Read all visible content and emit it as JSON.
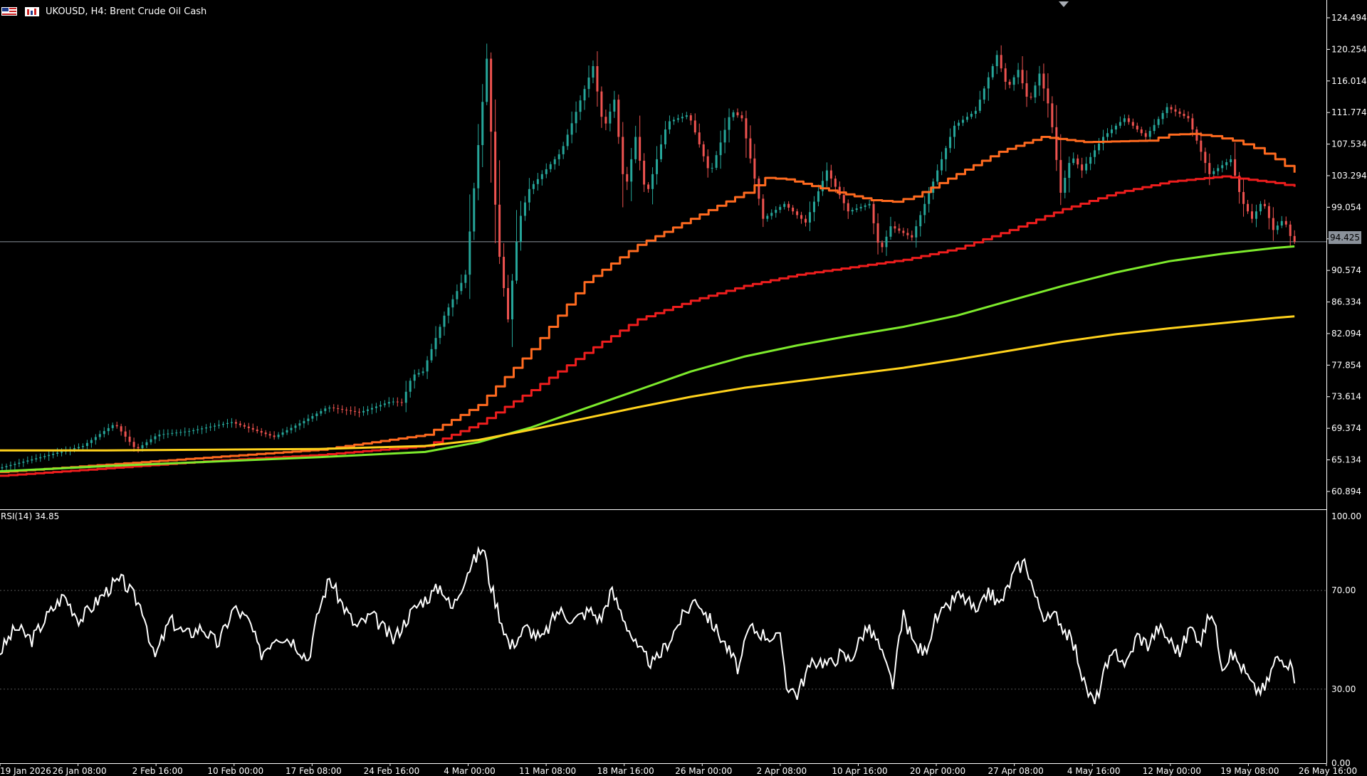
{
  "window": {
    "symbol_title": "UKOUSD, H4:  Brent Crude Oil Cash",
    "current_price": "94.425"
  },
  "colors": {
    "background": "#000000",
    "axis": "#ffffff",
    "ma_orange": "#ff6a1f",
    "ma_red": "#ee1d1d",
    "ma_green": "#7dea2c",
    "ma_yellow": "#ffd21c",
    "bull_candle": "#26a69a",
    "bear_candle": "#ef5350",
    "rsi_line": "#ffffff",
    "rsi_levels": "#555555"
  },
  "icons": [
    "flag-icon",
    "chart-type-icon"
  ],
  "chart_data": [
    {
      "type": "line",
      "title": "UKOUSD, H4:  Brent Crude Oil Cash",
      "price_ticks": [
        "124.494",
        "120.254",
        "116.014",
        "111.774",
        "107.534",
        "103.294",
        "99.054",
        "94.814",
        "90.574",
        "86.334",
        "82.094",
        "77.854",
        "73.614",
        "69.374",
        "65.134",
        "60.894"
      ],
      "ylim": [
        58.5,
        126.5
      ],
      "x_ticks": [
        "19 Jan 2026",
        "26 Jan 08:00",
        "2 Feb 16:00",
        "10 Feb 00:00",
        "17 Feb 08:00",
        "24 Feb 16:00",
        "4 Mar 00:00",
        "11 Mar 08:00",
        "18 Mar 16:00",
        "26 Mar 00:00",
        "2 Apr 08:00",
        "10 Apr 16:00",
        "20 Apr 00:00",
        "27 Apr 08:00",
        "4 May 16:00",
        "12 May 00:00",
        "19 May 08:00",
        "26 May 16:00"
      ],
      "xlim": [
        0,
        1248
      ],
      "price": {
        "x": [
          0,
          40,
          80,
          110,
          130,
          150,
          180,
          220,
          260,
          290,
          310,
          340,
          370,
          380,
          390,
          400,
          420,
          440,
          460,
          470,
          480,
          490,
          500,
          530,
          560,
          570,
          580,
          590,
          600,
          610,
          630,
          650,
          670,
          690,
          700,
          720,
          740,
          760,
          780,
          800,
          820,
          830,
          840,
          860,
          880,
          900,
          920,
          940,
          950,
          960,
          970,
          980,
          990,
          1000,
          1010,
          1020,
          1040,
          1060,
          1080,
          1100,
          1120,
          1140,
          1160,
          1170,
          1180,
          1190,
          1200,
          1210,
          1218
        ],
        "y": [
          64.0,
          65.5,
          67.0,
          70.0,
          66.5,
          68.5,
          69.0,
          70.2,
          68.2,
          70.5,
          72.2,
          71.5,
          73.0,
          72.8,
          76.5,
          77.0,
          84.5,
          90.0,
          119.0,
          94.5,
          84.0,
          97.0,
          101.5,
          106.5,
          118.0,
          109.5,
          113.5,
          101.0,
          108.5,
          100.5,
          110.5,
          111.5,
          103.5,
          112.0,
          111.0,
          97.5,
          99.5,
          97.0,
          104.0,
          98.5,
          99.5,
          93.0,
          96.5,
          95.0,
          102.5,
          110.0,
          112.0,
          119.5,
          115.0,
          117.5,
          113.0,
          117.0,
          112.0,
          101.0,
          106.0,
          104.0,
          108.5,
          111.0,
          108.5,
          112.5,
          111.0,
          103.5,
          105.5,
          100.0,
          97.5,
          100.0,
          96.0,
          97.5,
          94.425
        ]
      },
      "series": [
        {
          "name": "",
          "color": "#ff6a1f",
          "step": true,
          "x": [
            0,
            100,
            200,
            300,
            400,
            450,
            500,
            550,
            600,
            650,
            700,
            720,
            740,
            780,
            820,
            840,
            860,
            900,
            940,
            980,
            1020,
            1080,
            1100,
            1120,
            1140,
            1160,
            1180,
            1200,
            1218
          ],
          "y": [
            63.5,
            64.5,
            65.5,
            66.5,
            68.5,
            72.5,
            80.0,
            89.0,
            94.0,
            97.5,
            101.0,
            103.0,
            102.8,
            101.3,
            100.0,
            99.8,
            100.5,
            103.5,
            106.5,
            108.5,
            107.8,
            108.0,
            108.8,
            108.9,
            108.6,
            108.0,
            107.0,
            105.5,
            103.7
          ]
        },
        {
          "name": "",
          "color": "#ee1d1d",
          "step": true,
          "x": [
            0,
            100,
            200,
            300,
            400,
            450,
            500,
            550,
            600,
            650,
            700,
            750,
            800,
            850,
            900,
            950,
            1000,
            1050,
            1100,
            1150,
            1200,
            1218
          ],
          "y": [
            63.0,
            64.0,
            65.0,
            65.8,
            67.0,
            70.0,
            74.5,
            79.5,
            84.0,
            86.5,
            88.5,
            90.0,
            91.0,
            92.0,
            93.5,
            96.0,
            98.8,
            101.0,
            102.5,
            103.2,
            102.3,
            101.8
          ]
        },
        {
          "name": "",
          "color": "#7dea2c",
          "step": false,
          "x": [
            0,
            100,
            200,
            300,
            400,
            450,
            500,
            550,
            600,
            650,
            700,
            750,
            800,
            850,
            900,
            950,
            1000,
            1050,
            1100,
            1150,
            1200,
            1218
          ],
          "y": [
            63.6,
            64.3,
            64.9,
            65.5,
            66.2,
            67.5,
            69.5,
            72.0,
            74.5,
            77.0,
            79.0,
            80.5,
            81.8,
            83.0,
            84.5,
            86.5,
            88.5,
            90.3,
            91.8,
            92.8,
            93.6,
            93.8
          ]
        },
        {
          "name": "",
          "color": "#ffd21c",
          "step": false,
          "x": [
            0,
            100,
            200,
            300,
            400,
            450,
            500,
            550,
            600,
            650,
            700,
            750,
            800,
            850,
            900,
            950,
            1000,
            1050,
            1100,
            1150,
            1200,
            1218
          ],
          "y": [
            66.4,
            66.4,
            66.5,
            66.6,
            67.0,
            67.8,
            69.2,
            70.7,
            72.2,
            73.6,
            74.8,
            75.7,
            76.6,
            77.5,
            78.6,
            79.8,
            81.0,
            82.0,
            82.8,
            83.5,
            84.2,
            84.4
          ]
        }
      ]
    },
    {
      "type": "line",
      "title": "RSI(14) 34.85",
      "levels": [
        70,
        30
      ],
      "ylim": [
        0,
        100
      ],
      "y_ticks": [
        "100.00",
        "70.00",
        "30.00",
        "0.00"
      ],
      "x": [
        0,
        15,
        30,
        45,
        60,
        75,
        90,
        105,
        115,
        125,
        135,
        145,
        160,
        175,
        190,
        205,
        220,
        235,
        245,
        260,
        275,
        290,
        300,
        310,
        320,
        335,
        350,
        370,
        385,
        395,
        405,
        415,
        425,
        440,
        455,
        460,
        470,
        480,
        495,
        510,
        525,
        540,
        555,
        565,
        575,
        590,
        600,
        615,
        630,
        640,
        655,
        665,
        680,
        695,
        705,
        720,
        735,
        740,
        750,
        760,
        770,
        780,
        790,
        800,
        815,
        825,
        833,
        840,
        850,
        860,
        870,
        880,
        890,
        900,
        910,
        920,
        930,
        940,
        945,
        955,
        965,
        975,
        985,
        995,
        1000,
        1005,
        1013,
        1020,
        1030,
        1040,
        1050,
        1060,
        1070,
        1080,
        1090,
        1100,
        1110,
        1120,
        1130,
        1140,
        1150,
        1160,
        1170,
        1180,
        1190,
        1200,
        1210,
        1218
      ],
      "y": [
        45,
        55,
        50,
        60,
        68,
        58,
        65,
        72,
        74,
        68,
        62,
        42,
        58,
        52,
        55,
        48,
        63,
        57,
        44,
        52,
        50,
        42,
        62,
        75,
        66,
        55,
        60,
        50,
        60,
        65,
        68,
        72,
        62,
        78,
        88,
        75,
        60,
        47,
        55,
        50,
        62,
        58,
        62,
        58,
        70,
        56,
        46,
        40,
        50,
        58,
        67,
        60,
        50,
        38,
        55,
        52,
        50,
        32,
        28,
        38,
        42,
        40,
        44,
        42,
        55,
        50,
        40,
        32,
        60,
        48,
        45,
        58,
        62,
        68,
        66,
        60,
        70,
        64,
        68,
        78,
        82,
        66,
        58,
        60,
        55,
        52,
        45,
        32,
        24,
        38,
        45,
        40,
        52,
        48,
        55,
        50,
        45,
        55,
        50,
        62,
        40,
        44,
        38,
        30,
        30,
        42,
        42,
        35
      ]
    }
  ]
}
